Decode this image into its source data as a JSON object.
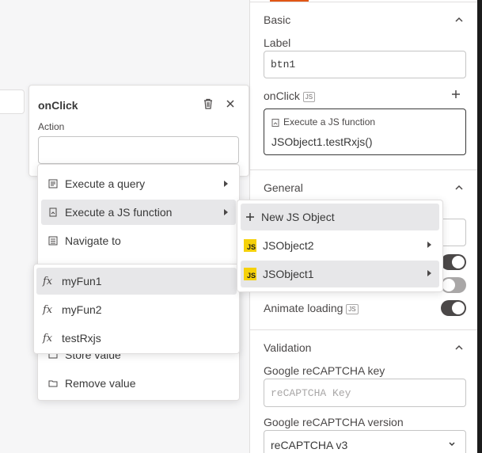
{
  "property_pane": {
    "basic": {
      "title": "Basic",
      "label_field": "Label",
      "label_value": "btn1",
      "onclick_label": "onClick",
      "js_tag": "JS",
      "action_type": "Execute a JS function",
      "action_value": "JSObject1.testRxjs()"
    },
    "general": {
      "title": "General",
      "animate_loading_label": "Animate loading",
      "js_tag": "JS"
    },
    "validation": {
      "title": "Validation",
      "recaptcha_key_label": "Google reCAPTCHA key",
      "recaptcha_key_placeholder": "reCAPTCHA Key",
      "recaptcha_version_label": "Google reCAPTCHA version",
      "recaptcha_version_value": "reCAPTCHA v3"
    }
  },
  "popover": {
    "title": "onClick",
    "action_label": "Action"
  },
  "action_menu": {
    "items": [
      {
        "label": "Execute a query",
        "icon": "query-icon"
      },
      {
        "label": "Execute a JS function",
        "icon": "js-function-icon"
      },
      {
        "label": "Navigate to",
        "icon": "navigate-icon"
      }
    ],
    "lower_items": [
      {
        "label": "Store value",
        "icon": "store-icon"
      },
      {
        "label": "Remove value",
        "icon": "folder-icon"
      }
    ]
  },
  "function_menu": {
    "items": [
      {
        "label": "myFun1",
        "icon": "fx-icon"
      },
      {
        "label": "myFun2",
        "icon": "fx-icon"
      },
      {
        "label": "testRxjs",
        "icon": "fx-icon"
      }
    ]
  },
  "js_object_menu": {
    "new_label": "New JS Object",
    "items": [
      {
        "label": "JSObject2",
        "badge": "JS"
      },
      {
        "label": "JSObject1",
        "badge": "JS"
      }
    ]
  },
  "colors": {
    "canvas_bg": "#f6f6f7",
    "accent_orange": "#e15615",
    "js_yellow": "#f5d10a",
    "toggle_on": "#4b4848",
    "hover_bg": "#e7e7e9"
  }
}
